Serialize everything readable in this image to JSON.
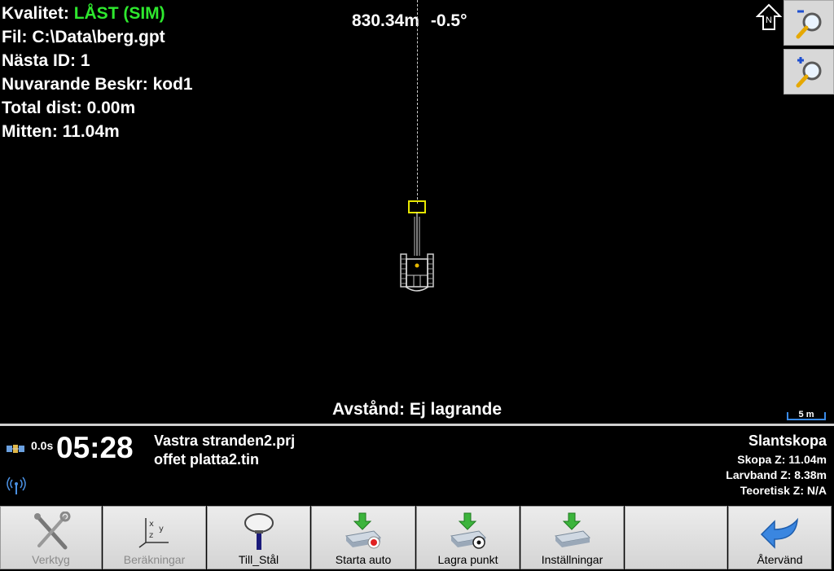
{
  "map": {
    "quality_label": "Kvalitet: ",
    "quality_value": "LÅST (SIM)",
    "file": "Fil: C:\\Data\\berg.gpt",
    "next_id": "Nästa ID: 1",
    "current_desc": "Nuvarande Beskr: kod1",
    "total_dist": "Total dist: 0.00m",
    "middle": "Mitten: 11.04m",
    "heading_distance": "830.34m",
    "heading_angle": "-0.5°",
    "distance_status": "Avstånd: Ej lagrande",
    "scale_label": "5 m",
    "north_label": "N",
    "quality_color": "#2ee82e",
    "target_color": "#e6e600"
  },
  "status": {
    "age": "0.0s",
    "clock": "05:28",
    "project": "Vastra stranden2.prj",
    "tin": "offet platta2.tin",
    "bucket_name": "Slantskopa",
    "bucket_z": "Skopa Z: 11.04m",
    "track_z": "Larvband Z: 8.38m",
    "theoretical_z": "Teoretisk Z: N/A"
  },
  "toolbar": {
    "tools": "Verktyg",
    "calculations": "Beräkningar",
    "to_steel": "Till_Stål",
    "start_auto": "Starta auto",
    "store_point": "Lagra punkt",
    "settings": "Inställningar",
    "back": "Återvänd"
  },
  "icons": [
    "north-arrow-icon",
    "zoom-out-icon",
    "zoom-in-icon",
    "satellite-icon",
    "radio-icon",
    "tools-icon",
    "xyz-axes-icon",
    "gnss-antenna-icon",
    "download-record-icon",
    "download-target-icon",
    "download-settings-icon",
    "return-arrow-icon"
  ]
}
